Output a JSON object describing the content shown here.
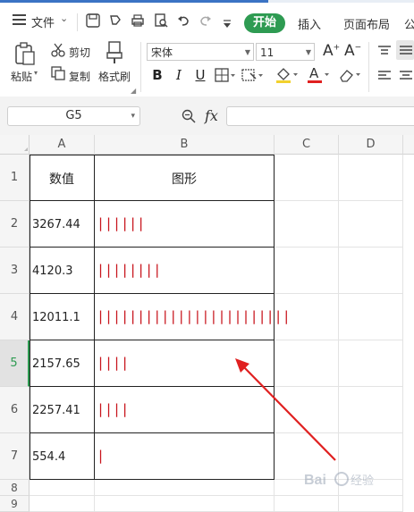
{
  "menubar": {
    "file_label": "文件",
    "tabs": [
      "开始",
      "插入",
      "页面布局",
      "公"
    ]
  },
  "ribbon": {
    "paste": "粘贴",
    "cut": "剪切",
    "copy": "复制",
    "format_painter": "格式刷",
    "font_name": "宋体",
    "font_size": "11",
    "increase_font": "A⁺",
    "decrease_font": "A⁻",
    "bold": "B",
    "italic": "I",
    "underline": "U"
  },
  "formula_bar": {
    "cell_ref": "G5",
    "fx": "fx",
    "value": ""
  },
  "sheet": {
    "columns": [
      "A",
      "B",
      "C",
      "D"
    ],
    "row_numbers": [
      "1",
      "2",
      "3",
      "4",
      "5",
      "6",
      "7",
      "8",
      "9"
    ],
    "header_a": "数值",
    "header_b": "图形",
    "rows": [
      {
        "value": "3267.44",
        "bars": "||||||"
      },
      {
        "value": "4120.3",
        "bars": "||||||||"
      },
      {
        "value": "12011.1",
        "bars": "||||||||||||||||||||||||"
      },
      {
        "value": "2157.65",
        "bars": "||||"
      },
      {
        "value": "2257.41",
        "bars": "||||"
      },
      {
        "value": "554.4",
        "bars": "|"
      }
    ],
    "selected_row": "5"
  },
  "colors": {
    "accent": "#2e9b52",
    "bar_color": "#c8141c",
    "arrow": "#e02020"
  },
  "watermark": "Bai du 经验"
}
